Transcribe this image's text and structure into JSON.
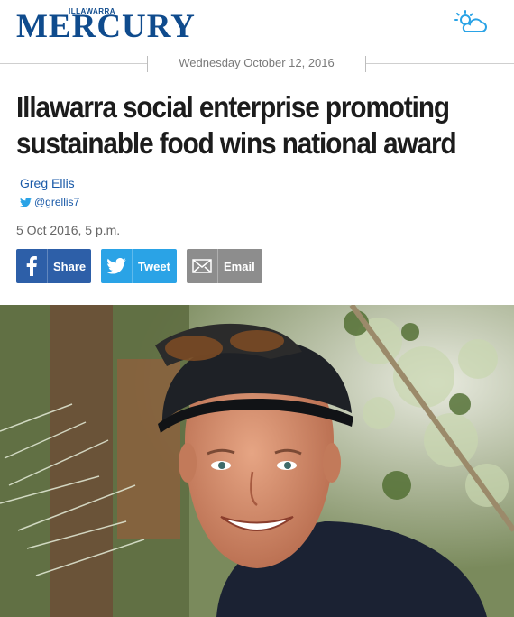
{
  "masthead": {
    "logo_small": "ILLAWARRA",
    "logo_main": "MERCURY",
    "weather_icon": "partly-sunny-icon",
    "brand_color": "#0f4b8d"
  },
  "dateline": {
    "date": "Wednesday October 12, 2016"
  },
  "article": {
    "headline_line1": "Illawarra social enterprise promoting",
    "headline_line2": "sustainable food wins national award",
    "author": "Greg Ellis",
    "twitter_handle": "@grellis7",
    "published": "5 Oct 2016, 5 p.m."
  },
  "share": {
    "facebook_label": "Share",
    "twitter_label": "Tweet",
    "email_label": "Email",
    "facebook_color": "#2d5fa8",
    "twitter_color": "#2aa3e6",
    "email_color": "#8d8d8d"
  },
  "photo": {
    "subject": "smiling man in black cap with sunglasses among foliage"
  }
}
